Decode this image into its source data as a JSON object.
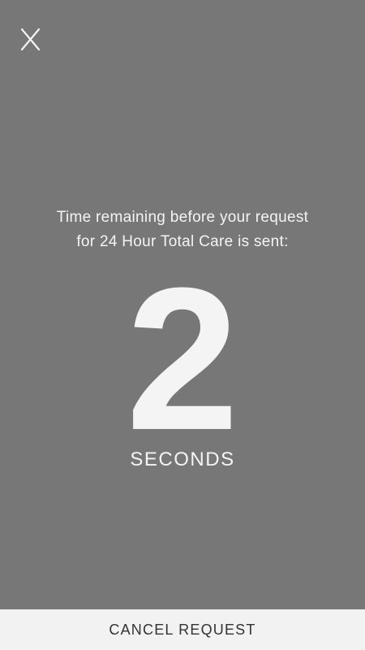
{
  "colors": {
    "background": "#777777",
    "foreground": "#f4f4f4",
    "bottom_bar": "#f2f2f2",
    "bottom_bar_text": "#333333"
  },
  "close_button": {
    "icon": "close-icon",
    "glyph": "X"
  },
  "message": {
    "line1": "Time remaining before your request",
    "line2": "for 24 Hour Total Care is sent:"
  },
  "countdown": {
    "value": "2",
    "unit": "SECONDS"
  },
  "cancel_button": {
    "label": "CANCEL REQUEST"
  }
}
